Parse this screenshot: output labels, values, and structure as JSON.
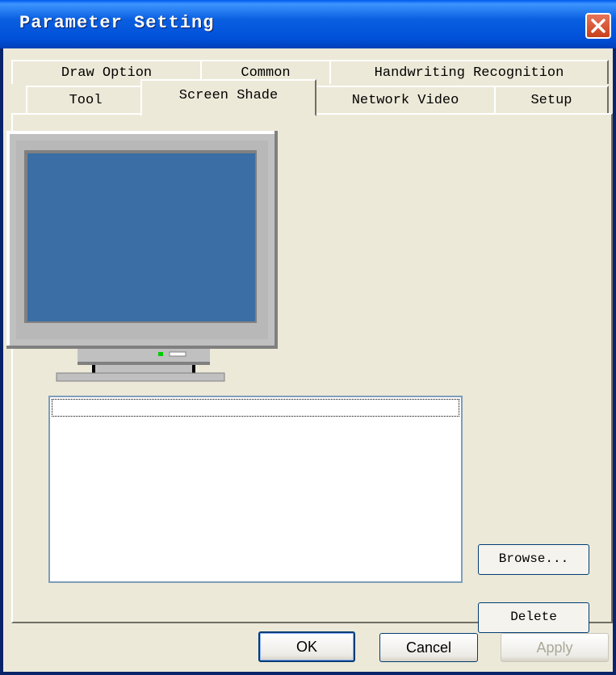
{
  "window": {
    "title": "Parameter Setting",
    "close_icon": "close-icon"
  },
  "tabs": {
    "row_back": [
      {
        "label": "Draw Option"
      },
      {
        "label": "Common"
      },
      {
        "label": "Handwriting Recognition"
      }
    ],
    "row_front": [
      {
        "label": "Tool"
      },
      {
        "label": "Screen Shade",
        "active": true
      },
      {
        "label": "Network Video"
      },
      {
        "label": "Setup"
      }
    ]
  },
  "screen_shade": {
    "monitor_icon": "monitor-icon",
    "list_items": [
      ""
    ],
    "browse_label": "Browse...",
    "delete_label": "Delete"
  },
  "footer": {
    "ok_label": "OK",
    "cancel_label": "Cancel",
    "apply_label": "Apply"
  },
  "colors": {
    "titlebar": "#0054e3",
    "dialog_bg": "#ece9d8",
    "screen": "#3a6ea5"
  }
}
